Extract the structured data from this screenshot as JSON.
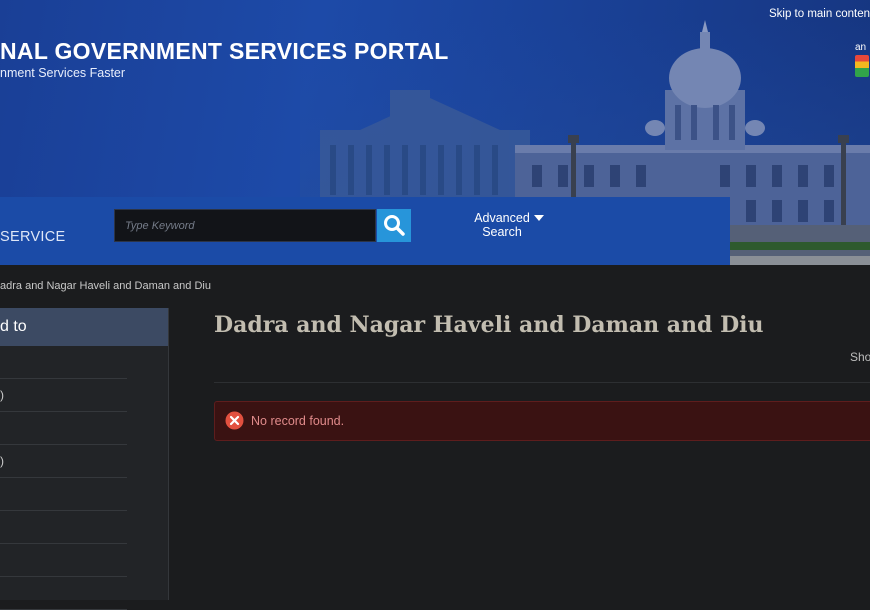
{
  "header": {
    "skip_link": "Skip to main conten",
    "title": "NAL GOVERNMENT SERVICES PORTAL",
    "subtitle": "nment Services Faster",
    "logo_text": "an",
    "logo_mark": "I"
  },
  "search": {
    "section_label": "SERVICE",
    "placeholder": "Type Keyword",
    "advanced_line1": "Advanced",
    "advanced_line2": "Search"
  },
  "breadcrumb": "adra and Nagar Haveli and Daman and Diu",
  "sidebar": {
    "heading": "d to",
    "items": [
      "",
      ")",
      "",
      ")",
      "",
      "",
      "",
      ""
    ]
  },
  "main": {
    "title": "Dadra and Nagar Haveli and Daman and Diu",
    "show_label": "Sho",
    "alert_message": "No record found."
  },
  "colors": {
    "header_blue": "#1d4aa8",
    "search_button": "#2795da",
    "sidebar_head": "#3c4a63",
    "alert_bg": "#3a1212",
    "alert_text": "#e08b8b",
    "alert_icon": "#e2503f",
    "title_text": "#c2bdb0"
  }
}
